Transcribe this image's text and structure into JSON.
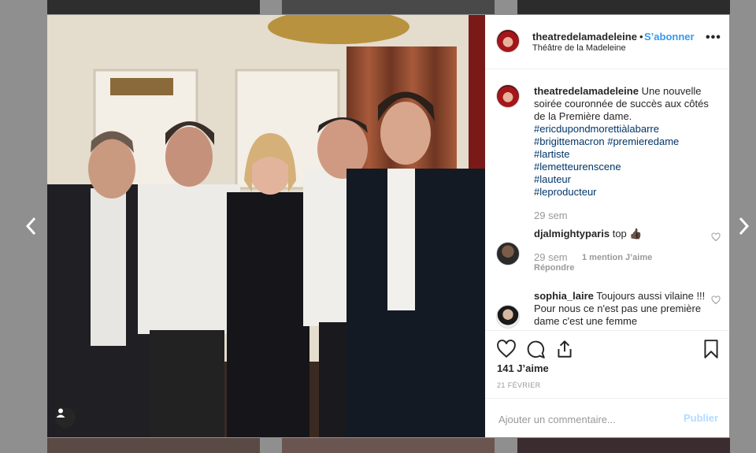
{
  "background": {
    "color": "#8f8f8f"
  },
  "nav": {
    "prev_icon": "chevron-left-icon",
    "next_icon": "chevron-right-icon"
  },
  "header": {
    "username": "theatredelamadeleine",
    "separator": "•",
    "follow_label": "S’abonner",
    "location": "Théâtre de la Madeleine",
    "more_icon": "more-options-icon",
    "more_label": "•••"
  },
  "caption": {
    "username": "theatredelamadeleine",
    "text": "Une nouvelle soirée couronnée de succès aux côtés de la Première dame.",
    "hashtags": [
      "#ericdupondmorettiàlabarre",
      "#brigittemacron #premieredame",
      "#lartiste",
      "#lemetteurenscene",
      "#lauteur",
      "#leproducteur"
    ],
    "time": "29 sem"
  },
  "comments": [
    {
      "username": "djalmightyparis",
      "text": "top 👍🏿",
      "time": "29 sem",
      "likes": "1 mention J’aime",
      "reply_label": "Répondre"
    },
    {
      "username": "sophia_laire",
      "text": "Toujours aussi vilaine !!! Pour nous ce n'est pas une première dame c'est une femme"
    }
  ],
  "actions": {
    "like_icon": "heart-icon",
    "comment_icon": "comment-icon",
    "share_icon": "share-icon",
    "save_icon": "bookmark-icon"
  },
  "likes": "141 J’aime",
  "date": "21 FÉVRIER",
  "add_comment": {
    "placeholder": "Ajouter un commentaire...",
    "publish_label": "Publier"
  },
  "colors": {
    "link": "#3897f0",
    "hashtag": "#003569",
    "muted": "#999999",
    "publish_disabled": "#b3dbff"
  }
}
